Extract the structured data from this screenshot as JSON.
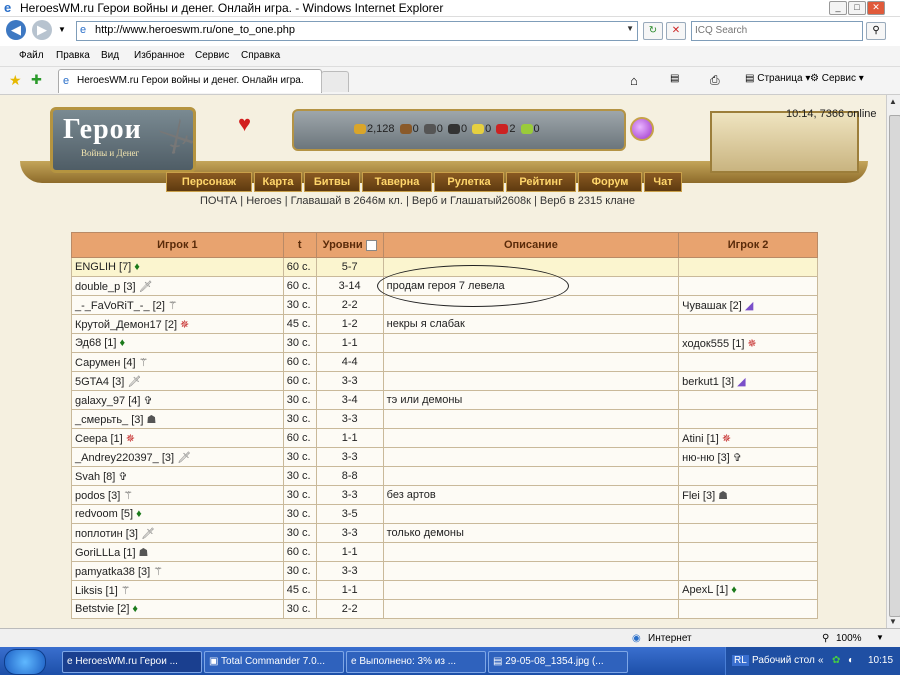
{
  "window": {
    "title": "HeroesWM.ru Герои войны и денег. Онлайн игра. - Windows Internet Explorer"
  },
  "address": {
    "url": "http://www.heroeswm.ru/one_to_one.php"
  },
  "search": {
    "placeholder": "ICQ Search"
  },
  "menu": [
    "Файл",
    "Правка",
    "Вид",
    "Избранное",
    "Сервис",
    "Справка"
  ],
  "tab": {
    "label": "HeroesWM.ru Герои войны и денег. Онлайн игра."
  },
  "toolbar": {
    "page_label": "Страница",
    "tools_label": "Сервис"
  },
  "game": {
    "logo_title": "Герои",
    "logo_subtitle": "Войны и Денег",
    "clock": "10:14, 7366 online",
    "resources": [
      "2,128",
      "0",
      "0",
      "0",
      "0",
      "2",
      "0"
    ],
    "nav": [
      "Персонаж",
      "Карта",
      "Битвы",
      "Таверна",
      "Рулетка",
      "Рейтинг",
      "Форум",
      "Чат"
    ],
    "links": "ПОЧТА | Heroes | Главашай в 2646м кл. | Верб и Глашатый2608к | Верб в 2315 клане"
  },
  "table": {
    "headers": [
      "Игрок 1",
      "t",
      "Уровни",
      "Описание",
      "Игрок 2"
    ],
    "rows": [
      {
        "p1": "ENGLIH [7]",
        "i1": "♦",
        "t": "60 с.",
        "lvl": "5-7",
        "desc": "",
        "p2": "",
        "i2": ""
      },
      {
        "p1": "double_p [3]",
        "i1": "🗡",
        "t": "60 с.",
        "lvl": "3-14",
        "desc": "продам героя 7 левела",
        "p2": "",
        "i2": ""
      },
      {
        "p1": "_-_FaVoRiT_-_ [2]",
        "i1": "⚚",
        "t": "30 с.",
        "lvl": "2-2",
        "desc": "",
        "p2": "Чувашак [2]",
        "i2": "◢"
      },
      {
        "p1": "Крутой_Демон17 [2]",
        "i1": "✵",
        "t": "45 с.",
        "lvl": "1-2",
        "desc": "некры я слабак",
        "p2": "",
        "i2": ""
      },
      {
        "p1": "Эд68 [1]",
        "i1": "♦",
        "t": "30 с.",
        "lvl": "1-1",
        "desc": "",
        "p2": "ходок555 [1]",
        "i2": "✵"
      },
      {
        "p1": "Сарумен [4]",
        "i1": "⚚",
        "t": "60 с.",
        "lvl": "4-4",
        "desc": "",
        "p2": "",
        "i2": ""
      },
      {
        "p1": "5GTA4 [3]",
        "i1": "🗡",
        "t": "60 с.",
        "lvl": "3-3",
        "desc": "",
        "p2": "berkut1 [3]",
        "i2": "◢"
      },
      {
        "p1": "galaxy_97 [4]",
        "i1": "✞",
        "t": "30 с.",
        "lvl": "3-4",
        "desc": "тэ или демоны",
        "p2": "",
        "i2": ""
      },
      {
        "p1": "_смерьть_ [3]",
        "i1": "☗",
        "t": "30 с.",
        "lvl": "3-3",
        "desc": "",
        "p2": "",
        "i2": ""
      },
      {
        "p1": "Сеера [1]",
        "i1": "✵",
        "t": "60 с.",
        "lvl": "1-1",
        "desc": "",
        "p2": "Atini [1]",
        "i2": "✵"
      },
      {
        "p1": "_Andrey220397_ [3]",
        "i1": "🗡",
        "t": "30 с.",
        "lvl": "3-3",
        "desc": "",
        "p2": "ню-ню [3]",
        "i2": "✞"
      },
      {
        "p1": "Svah [8]",
        "i1": "✞",
        "t": "30 с.",
        "lvl": "8-8",
        "desc": "",
        "p2": "",
        "i2": ""
      },
      {
        "p1": "podos [3]",
        "i1": "⚚",
        "t": "30 с.",
        "lvl": "3-3",
        "desc": "без артов",
        "p2": "Flei [3]",
        "i2": "☗"
      },
      {
        "p1": "redvoom [5]",
        "i1": "♦",
        "t": "30 с.",
        "lvl": "3-5",
        "desc": "",
        "p2": "",
        "i2": ""
      },
      {
        "p1": "поплотин [3]",
        "i1": "🗡",
        "t": "30 с.",
        "lvl": "3-3",
        "desc": "только демоны",
        "p2": "",
        "i2": ""
      },
      {
        "p1": "GoriLLLa [1]",
        "i1": "☗",
        "t": "60 с.",
        "lvl": "1-1",
        "desc": "",
        "p2": "",
        "i2": ""
      },
      {
        "p1": "pamyatka38 [3]",
        "i1": "⚚",
        "t": "30 с.",
        "lvl": "3-3",
        "desc": "",
        "p2": "",
        "i2": ""
      },
      {
        "p1": "Liksis [1]",
        "i1": "⚚",
        "t": "45 с.",
        "lvl": "1-1",
        "desc": "",
        "p2": "ApexL [1]",
        "i2": "♦"
      },
      {
        "p1": "Betstvie [2]",
        "i1": "♦",
        "t": "30 с.",
        "lvl": "2-2",
        "desc": "",
        "p2": "",
        "i2": ""
      }
    ]
  },
  "status": {
    "zone": "Интернет",
    "zoom": "100%"
  },
  "taskbar": {
    "tasks": [
      "HeroesWM.ru Герои ...",
      "Total Commander 7.0...",
      "Выполнено: 3% из ...",
      "29-05-08_1354.jpg (..."
    ],
    "lang": "RL",
    "desktop": "Рабочий стол",
    "time": "10:15"
  },
  "colors": {
    "header": "#e8a36f",
    "highlight_row": "#fbf5cf",
    "nav_text": "#ffd66b"
  }
}
